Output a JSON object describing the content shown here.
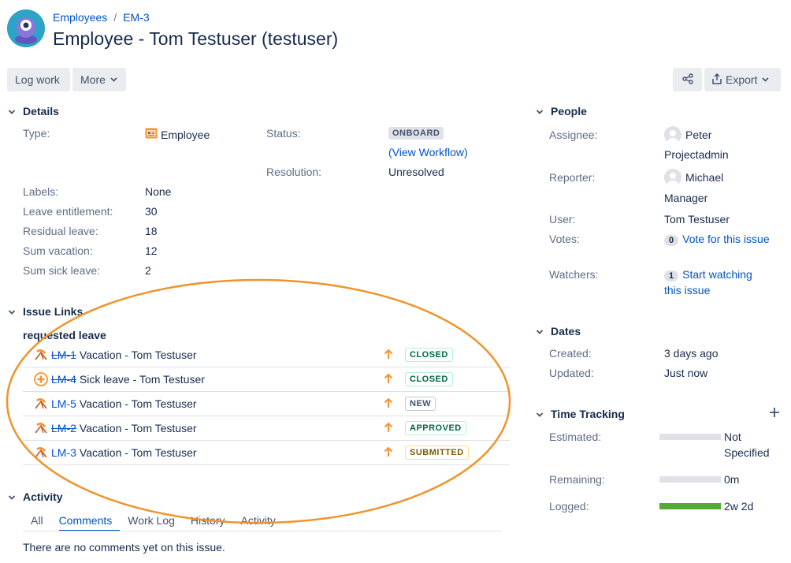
{
  "breadcrumb": {
    "project": "Employees",
    "issue_key": "EM-3"
  },
  "title": "Employee - Tom Testuser (testuser)",
  "toolbar": {
    "log_work": "Log work",
    "more": "More",
    "export": "Export"
  },
  "details": {
    "heading": "Details",
    "type_label": "Type:",
    "type_value": "Employee",
    "status_label": "Status:",
    "status_value": "ONBOARD",
    "view_workflow_open": "(",
    "view_workflow": "View Workflow",
    "view_workflow_close": ")",
    "resolution_label": "Resolution:",
    "resolution_value": "Unresolved",
    "fields": [
      {
        "label": "Labels:",
        "value": "None"
      },
      {
        "label": "Leave entitlement:",
        "value": "30"
      },
      {
        "label": "Residual leave:",
        "value": "18"
      },
      {
        "label": "Sum vacation:",
        "value": "12"
      },
      {
        "label": "Sum sick leave:",
        "value": "2"
      }
    ]
  },
  "issue_links": {
    "heading": "Issue Links",
    "group_label": "requested leave",
    "rows": [
      {
        "key": "LM-1",
        "summary": "Vacation - Tom Testuser",
        "status": "CLOSED",
        "icon": "beach-chair-icon",
        "resolved": true
      },
      {
        "key": "LM-4",
        "summary": "Sick leave - Tom Testuser",
        "status": "CLOSED",
        "icon": "medical-cross-icon",
        "resolved": true
      },
      {
        "key": "LM-5",
        "summary": "Vacation - Tom Testuser",
        "status": "NEW",
        "icon": "beach-chair-icon",
        "resolved": false
      },
      {
        "key": "LM-2",
        "summary": "Vacation - Tom Testuser",
        "status": "APPROVED",
        "icon": "beach-chair-icon",
        "resolved": true
      },
      {
        "key": "LM-3",
        "summary": "Vacation - Tom Testuser",
        "status": "SUBMITTED",
        "icon": "beach-chair-icon",
        "resolved": false
      }
    ]
  },
  "activity": {
    "heading": "Activity",
    "tabs": [
      "All",
      "Comments",
      "Work Log",
      "History",
      "Activity"
    ],
    "active_tab": "Comments",
    "empty_text": "There are no comments yet on this issue."
  },
  "people": {
    "heading": "People",
    "assignee_label": "Assignee:",
    "assignee_first": "Peter",
    "assignee_last": "Projectadmin",
    "reporter_label": "Reporter:",
    "reporter_first": "Michael",
    "reporter_last": "Manager",
    "user_label": "User:",
    "user_value": "Tom Testuser",
    "votes_label": "Votes:",
    "votes_count": "0",
    "votes_link": "Vote for this issue",
    "watchers_label": "Watchers:",
    "watchers_count": "1",
    "watchers_link_1": "Start watching",
    "watchers_link_2": "this issue"
  },
  "dates": {
    "heading": "Dates",
    "created_label": "Created:",
    "created_value": "3 days ago",
    "updated_label": "Updated:",
    "updated_value": "Just now"
  },
  "time_tracking": {
    "heading": "Time Tracking",
    "estimated_label": "Estimated:",
    "estimated_value_1": "Not",
    "estimated_value_2": "Specified",
    "remaining_label": "Remaining:",
    "remaining_value": "0m",
    "logged_label": "Logged:",
    "logged_value": "2w 2d",
    "logged_fraction": 1.0
  },
  "colors": {
    "accent": "#0052cc",
    "highlight_ellipse": "#f0932b",
    "logged_bar": "#57a936",
    "priority_arrow": "#f79232"
  }
}
